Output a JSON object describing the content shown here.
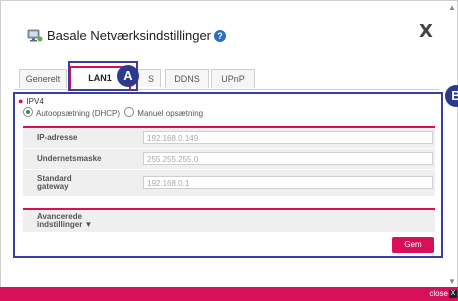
{
  "dialog": {
    "title": "Basale Netværksindstillinger",
    "help_icon": "?",
    "close_label": "X"
  },
  "tabs": [
    {
      "label": "Generelt",
      "active": false
    },
    {
      "label": "LAN1",
      "active": true
    },
    {
      "label": "S",
      "active": false
    },
    {
      "label": "DDNS",
      "active": false
    },
    {
      "label": "UPnP",
      "active": false
    }
  ],
  "callouts": {
    "a": "A",
    "b": "B"
  },
  "section": {
    "heading": "IPV4",
    "radio_auto": "Autoopsætning (DHCP)",
    "radio_manual": "Manuel opsætning",
    "selected": "auto"
  },
  "fields": [
    {
      "label": "IP-adresse",
      "value": "192.168.0.149"
    },
    {
      "label": "Undernetsmaske",
      "value": "255.255.255.0"
    },
    {
      "label_line1": "Standard",
      "label_line2": "gateway",
      "value": "192.168.0.1"
    }
  ],
  "advanced": {
    "line1": "Avancerede",
    "line2": "indstillinger ▼"
  },
  "save_label": "Gem",
  "footer": {
    "close_label": "close",
    "close_box": "X"
  },
  "colors": {
    "accent": "#d80f5a",
    "callout": "#2b3a8c"
  }
}
